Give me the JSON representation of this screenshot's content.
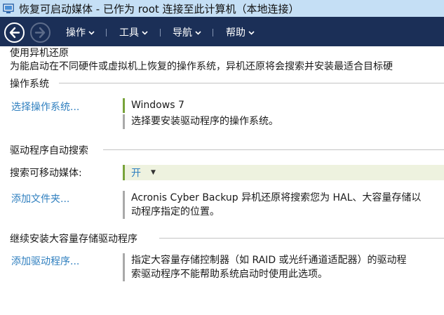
{
  "window": {
    "title": "恢复可启动媒体 - 已作为 root 连接至此计算机（本地连接）"
  },
  "nav": {
    "back_icon": "arrow-left-icon",
    "forward_icon": "arrow-right-icon",
    "menus": [
      {
        "label": "操作"
      },
      {
        "label": "工具"
      },
      {
        "label": "导航"
      },
      {
        "label": "帮助"
      }
    ]
  },
  "intro": {
    "title": "使用异机还原",
    "desc": "为能启动在不同硬件或虚拟机上恢复的操作系统，异机还原将会搜索并安装最适合目标硬"
  },
  "os_section": {
    "heading": "操作系统",
    "link": "选择操作系统...",
    "value": "Windows 7",
    "hint": "选择要安装驱动程序的操作系统。"
  },
  "auto_search_section": {
    "heading": "驱动程序自动搜索",
    "removable_label": "搜索可移动媒体:",
    "removable_value": "开",
    "add_folder_link": "添加文件夹...",
    "add_folder_desc_1": "Acronis Cyber Backup 异机还原将搜索您为 HAL、大容量存储以",
    "add_folder_desc_2": "动程序指定的位置。"
  },
  "mass_storage_section": {
    "heading": "继续安装大容量存储驱动程序",
    "link": "添加驱动程序...",
    "desc_1": "指定大容量存储控制器（如 RAID 或光纤通道适配器）的驱动程",
    "desc_2": "索驱动程序不能帮助系统启动时使用此选项。"
  },
  "colors": {
    "titlebar": "#c5dff5",
    "navbar": "#1b2f57",
    "link": "#2f7fbf",
    "accent_green": "#78a33a"
  }
}
